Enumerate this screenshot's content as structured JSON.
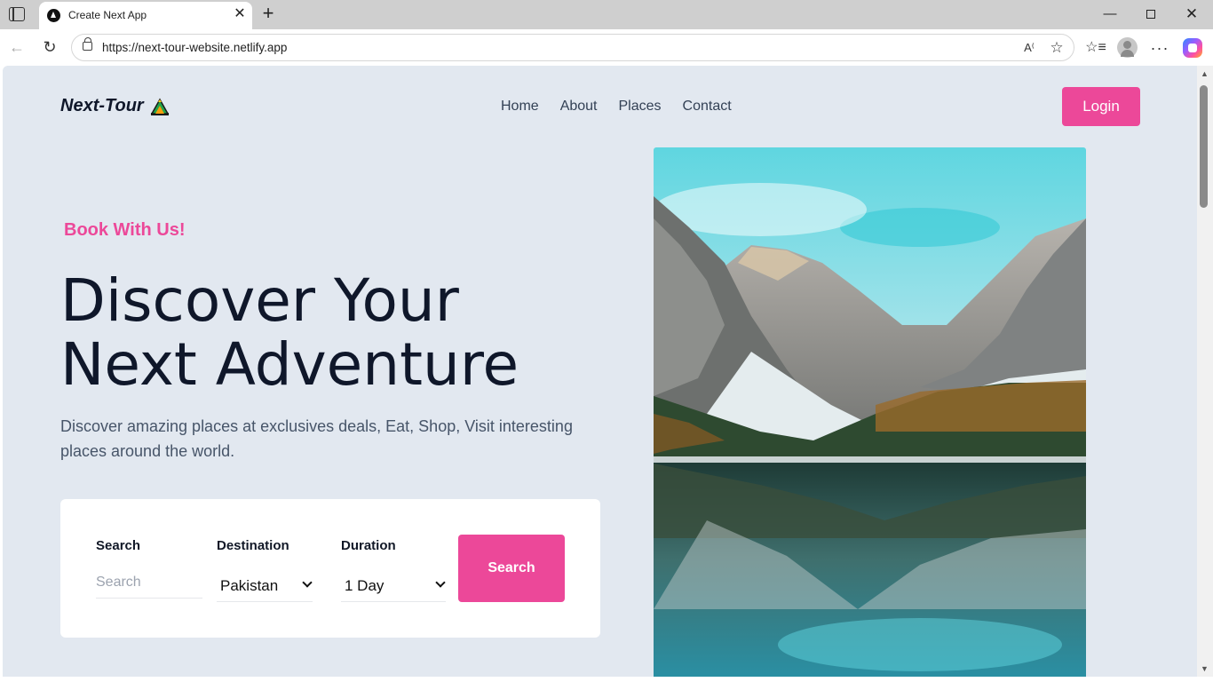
{
  "browser": {
    "tab_title": "Create Next App",
    "url": "https://next-tour-website.netlify.app",
    "tab_close_glyph": "✕",
    "new_tab_glyph": "+",
    "icons": [
      "tab-strip-icon",
      "favicon-icon",
      "close-icon",
      "plus-icon",
      "minimize-icon",
      "maximize-icon",
      "back-arrow-icon",
      "reload-icon",
      "lock-icon",
      "read-aloud-icon",
      "star-icon",
      "favorites-icon",
      "profile-icon",
      "more-icon",
      "copilot-icon"
    ]
  },
  "site": {
    "logo": "Next-Tour",
    "nav": [
      "Home",
      "About",
      "Places",
      "Contact"
    ],
    "login_label": "Login",
    "tagline": "Book With Us!",
    "headline_line1": "Discover Your",
    "headline_line2": "Next Adventure",
    "subtext": "Discover amazing places at exclusives deals, Eat, Shop, Visit interesting places around the world.",
    "search_form": {
      "search_label": "Search",
      "search_placeholder": "Search",
      "destination_label": "Destination",
      "destination_value": "Pakistan",
      "duration_label": "Duration",
      "duration_value": "1 Day",
      "button_label": "Search"
    }
  },
  "colors": {
    "accent": "#ec4899",
    "page_bg": "#e2e8f0",
    "heading": "#0f172a",
    "body_text": "#475569"
  }
}
